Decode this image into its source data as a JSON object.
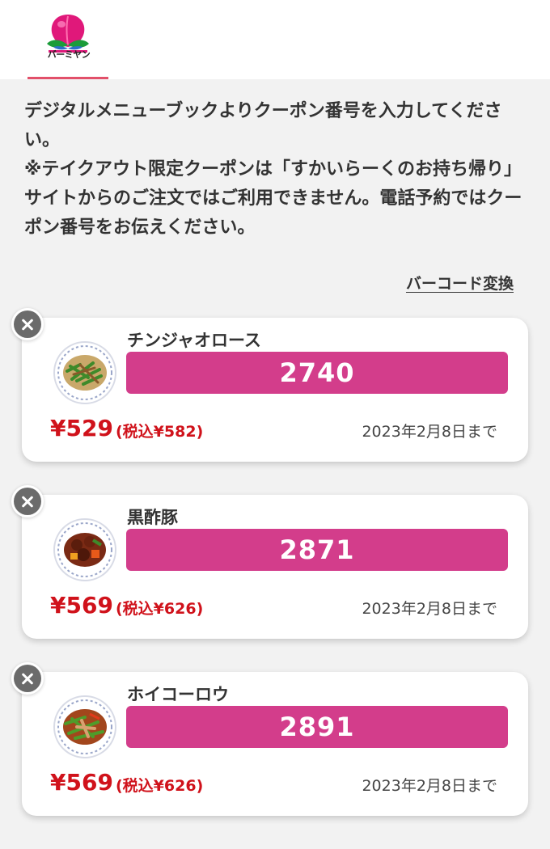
{
  "brand": {
    "logo_text": "バーミヤン",
    "accent_color": "#e2506a",
    "code_color": "#d33d8b",
    "price_color": "#d0121b"
  },
  "notice": {
    "line1": "デジタルメニューブックよりクーポン番号を入力してください。",
    "line2": "※テイクアウト限定クーポンは「すかいらーくのお持ち帰り」サイトからのご注文ではご利用できません。電話予約ではクーポン番号をお伝えください。"
  },
  "barcode_link": "バーコード変換",
  "coupons": [
    {
      "name": "チンジャオロース",
      "code": "2740",
      "price": "¥529",
      "tax_price": "(税込¥582)",
      "expiry": "2023年2月8日まで",
      "dish_icon": "green-pepper-stir-fry-plate"
    },
    {
      "name": "黒酢豚",
      "code": "2871",
      "price": "¥569",
      "tax_price": "(税込¥626)",
      "expiry": "2023年2月8日まで",
      "dish_icon": "sweet-and-sour-pork-plate"
    },
    {
      "name": "ホイコーロウ",
      "code": "2891",
      "price": "¥569",
      "tax_price": "(税込¥626)",
      "expiry": "2023年2月8日まで",
      "dish_icon": "twice-cooked-pork-plate"
    }
  ]
}
